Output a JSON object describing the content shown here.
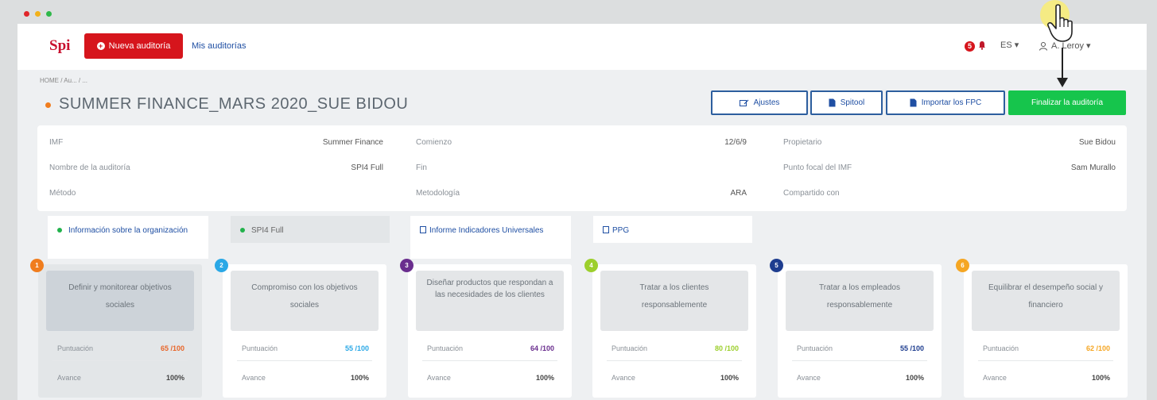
{
  "topbar": {
    "logo": "Spi",
    "new_audit_label": "Nueva auditoría",
    "my_audits_label": "Mis auditorías",
    "notification_count": "5",
    "language": "ES ▾",
    "user_name": "A. Leroy ▾"
  },
  "breadcrumb": "HOME / Au... / ...",
  "page_title": "SUMMER FINANCE_MARS 2020_SUE BIDOU",
  "actions": {
    "settings": "Ajustes",
    "spiltool": "Spitool",
    "import": "Importar los FPC",
    "finish": "Finalizar la auditoría"
  },
  "info": {
    "col1": [
      {
        "label": "IMF",
        "value": "Summer Finance"
      },
      {
        "label": "Nombre de la auditoría",
        "value": "SPI4 Full"
      },
      {
        "label": "Método",
        "value": ""
      }
    ],
    "col2": [
      {
        "label": "Comienzo",
        "value": "12/6/9"
      },
      {
        "label": "Fin",
        "value": ""
      },
      {
        "label": "Metodología",
        "value": "ARA"
      }
    ],
    "col3": [
      {
        "label": "Propietario",
        "value": "Sue Bidou"
      },
      {
        "label": "Punto focal del IMF",
        "value": "Sam Murallo"
      },
      {
        "label": "Compartido con",
        "value": ""
      }
    ]
  },
  "tabs": [
    {
      "label": "Información sobre la organización"
    },
    {
      "label": "SPI4 Full"
    },
    {
      "label": "Informe Indicadores Universales"
    },
    {
      "label": "PPG"
    }
  ],
  "cards_common": {
    "score_label": "Puntuación",
    "progress_label": "Avance"
  },
  "cards": [
    {
      "number": "1",
      "color": "#f07d1e",
      "title": "Definir y monitorear objetivos sociales",
      "score": "65 /100",
      "score_color": "#e8662a",
      "progress": "100%"
    },
    {
      "number": "2",
      "color": "#2aa8e6",
      "title": "Compromiso con los objetivos sociales",
      "score": "55 /100",
      "score_color": "#2aa8e6",
      "progress": "100%"
    },
    {
      "number": "3",
      "color": "#6a2e8e",
      "title": "Diseñar productos que respondan a las necesidades de los clientes",
      "score": "64 /100",
      "score_color": "#6a2e8e",
      "progress": "100%"
    },
    {
      "number": "4",
      "color": "#9ccf2c",
      "title": "Tratar a los clientes responsablemente",
      "score": "80 /100",
      "score_color": "#9ccf2c",
      "progress": "100%"
    },
    {
      "number": "5",
      "color": "#1e3d8f",
      "title": "Tratar a los empleados responsablemente",
      "score": "55 /100",
      "score_color": "#1e3d8f",
      "progress": "100%"
    },
    {
      "number": "6",
      "color": "#f5a623",
      "title": "Equilibrar el desempeño social y financiero",
      "score": "62 /100",
      "score_color": "#f5a623",
      "progress": "100%"
    }
  ],
  "colors": {
    "brand_red": "#d6151c",
    "accent_blue": "#1f4fa3",
    "success_green": "#16c54c"
  }
}
